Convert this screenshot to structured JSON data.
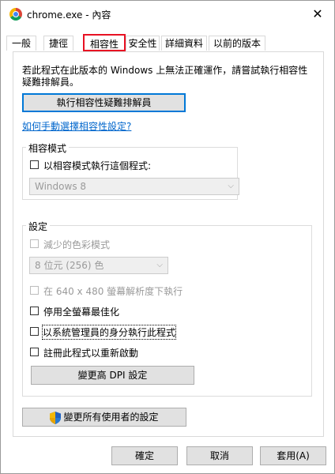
{
  "window": {
    "title": "chrome.exe - 內容",
    "close_symbol": "✕"
  },
  "tabs": [
    {
      "label": "一般"
    },
    {
      "label": "捷徑"
    },
    {
      "label": "相容性"
    },
    {
      "label": "安全性"
    },
    {
      "label": "詳細資料"
    },
    {
      "label": "以前的版本"
    }
  ],
  "compat": {
    "intro_line1": "若此程式在此版本的 Windows 上無法正確運作，請嘗試執行相容性",
    "intro_line2": "疑難排解員。",
    "troubleshooter_button": "執行相容性疑難排解員",
    "manual_link": "如何手動選擇相容性設定?",
    "mode_group_label": "相容模式",
    "mode_checkbox_label": "以相容模式執行這個程式:",
    "mode_select_value": "Windows 8",
    "settings_group_label": "設定",
    "reduced_color_label": "減少的色彩模式",
    "color_select_value": "8 位元 (256) 色",
    "res_640_label": "在 640 x 480 螢幕解析度下執行",
    "fullscreen_opt_label": "停用全螢幕最佳化",
    "run_as_admin_label": "以系統管理員的身分執行此程式",
    "register_restart_label": "註冊此程式以重新啟動",
    "dpi_button": "變更高 DPI 設定",
    "all_users_button": "變更所有使用者的設定"
  },
  "footer": {
    "ok_button": "確定",
    "cancel_button": "取消",
    "apply_button": "套用(A)"
  },
  "colors": {
    "active_tab_border": "#e81123",
    "focus_blue": "#0078d7",
    "link": "#0066cc"
  }
}
